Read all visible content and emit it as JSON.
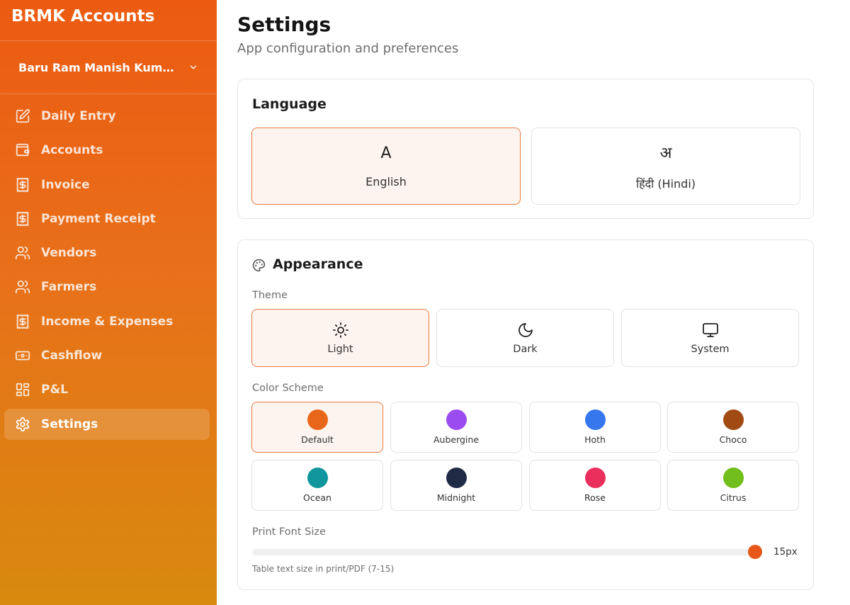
{
  "app": {
    "title": "BRMK Accounts"
  },
  "business": {
    "name": "Baru Ram Manish Kumar Ve..."
  },
  "nav": {
    "items": [
      {
        "label": "Daily Entry",
        "icon": "edit-icon"
      },
      {
        "label": "Accounts",
        "icon": "wallet-icon"
      },
      {
        "label": "Invoice",
        "icon": "receipt-icon"
      },
      {
        "label": "Payment Receipt",
        "icon": "receipt-icon"
      },
      {
        "label": "Vendors",
        "icon": "users-icon"
      },
      {
        "label": "Farmers",
        "icon": "users-icon"
      },
      {
        "label": "Income & Expenses",
        "icon": "receipt-icon"
      },
      {
        "label": "Cashflow",
        "icon": "banknote-icon"
      },
      {
        "label": "P&L",
        "icon": "dashboard-icon"
      },
      {
        "label": "Settings",
        "icon": "gear-icon",
        "active": true
      }
    ]
  },
  "page": {
    "title": "Settings",
    "subtitle": "App configuration and preferences"
  },
  "language": {
    "title": "Language",
    "options": [
      {
        "glyph": "A",
        "label": "English",
        "selected": true
      },
      {
        "glyph": "अ",
        "label": "हिंदी (Hindi)",
        "selected": false
      }
    ]
  },
  "appearance": {
    "title": "Appearance",
    "icon": "palette-icon",
    "theme_label": "Theme",
    "themes": [
      {
        "label": "Light",
        "icon": "sun-icon",
        "selected": true
      },
      {
        "label": "Dark",
        "icon": "moon-icon",
        "selected": false
      },
      {
        "label": "System",
        "icon": "monitor-icon",
        "selected": false
      }
    ],
    "scheme_label": "Color Scheme",
    "schemes": [
      {
        "label": "Default",
        "color": "#e8661a",
        "selected": true
      },
      {
        "label": "Aubergine",
        "color": "#9b4cf0",
        "selected": false
      },
      {
        "label": "Hoth",
        "color": "#3677ee",
        "selected": false
      },
      {
        "label": "Choco",
        "color": "#a14a12",
        "selected": false
      },
      {
        "label": "Ocean",
        "color": "#11969e",
        "selected": false
      },
      {
        "label": "Midnight",
        "color": "#1f2a44",
        "selected": false
      },
      {
        "label": "Rose",
        "color": "#ea2f5c",
        "selected": false
      },
      {
        "label": "Citrus",
        "color": "#72be1c",
        "selected": false
      }
    ],
    "print_font": {
      "label": "Print Font Size",
      "min": 7,
      "max": 15,
      "value": 15,
      "value_text": "15px",
      "hint": "Table text size in print/PDF (7-15)"
    }
  },
  "colors": {
    "accent": "#e8581a",
    "sidebar_top": "#ec5a12",
    "sidebar_bottom": "#d88a0e"
  }
}
